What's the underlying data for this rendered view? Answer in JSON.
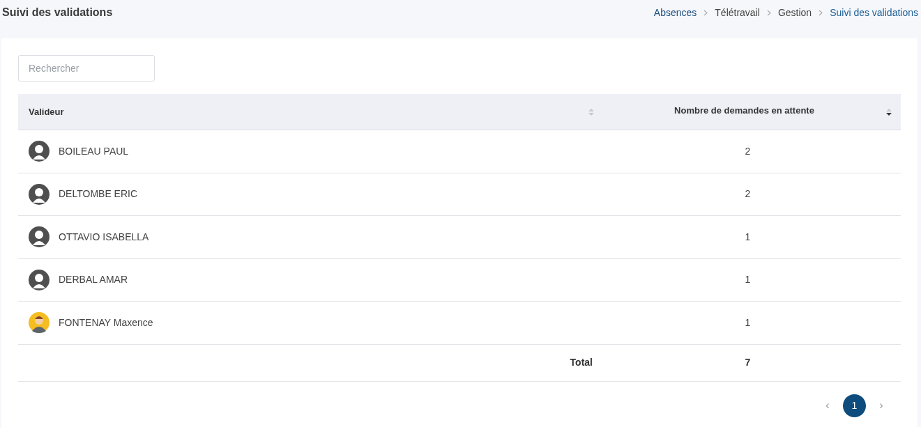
{
  "page_title": "Suivi des validations",
  "breadcrumb": [
    {
      "label": "Absences",
      "kind": "link"
    },
    {
      "label": "Télétravail",
      "kind": "text"
    },
    {
      "label": "Gestion",
      "kind": "text"
    },
    {
      "label": "Suivi des validations",
      "kind": "current"
    }
  ],
  "search": {
    "placeholder": "Rechercher"
  },
  "table": {
    "columns": [
      {
        "label": "Valideur",
        "sorted": false
      },
      {
        "label": "Nombre de demandes en attente",
        "sorted": true
      }
    ],
    "rows": [
      {
        "kind": "default",
        "name": "BOILEAU PAUL",
        "count": "2"
      },
      {
        "kind": "default",
        "name": "DELTOMBE ERIC",
        "count": "2"
      },
      {
        "kind": "default",
        "name": "OTTAVIO ISABELLA",
        "count": "1"
      },
      {
        "kind": "default",
        "name": "DERBAL AMAR",
        "count": "1"
      },
      {
        "kind": "photo",
        "name": "FONTENAY Maxence",
        "count": "1"
      }
    ],
    "total": {
      "label": "Total",
      "value": "7"
    }
  },
  "pagination": {
    "prev": "‹",
    "next": "›",
    "pages": [
      {
        "label": "1",
        "selected": true
      }
    ]
  }
}
